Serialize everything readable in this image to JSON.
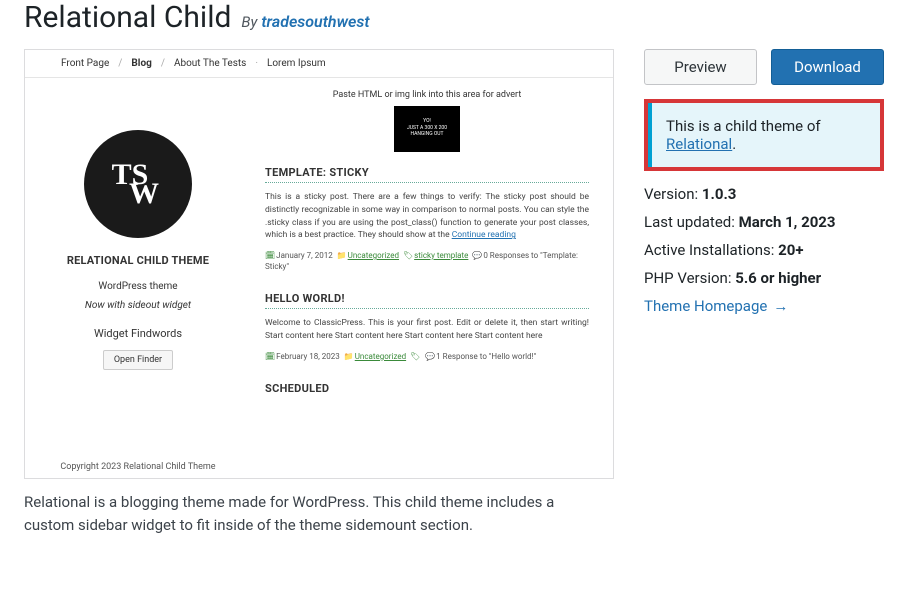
{
  "header": {
    "title": "Relational Child",
    "by_label": "By",
    "author": "tradesouthwest"
  },
  "actions": {
    "preview": "Preview",
    "download": "Download"
  },
  "notice": {
    "text_before": "This is a child theme of ",
    "parent_name": "Relational",
    "text_after": "."
  },
  "meta": {
    "version_label": "Version:",
    "version_value": "1.0.3",
    "updated_label": "Last updated:",
    "updated_value": "March 1, 2023",
    "installs_label": "Active Installations:",
    "installs_value": "20+",
    "php_label": "PHP Version:",
    "php_value": "5.6 or higher",
    "homepage_label": "Theme Homepage"
  },
  "description": "Relational is a blogging theme made for WordPress. This child theme includes a custom sidebar widget to fit inside of the theme sidemount section.",
  "screenshot": {
    "nav": {
      "item1": "Front Page",
      "item2": "Blog",
      "item3": "About The Tests",
      "item4": "Lorem Ipsum"
    },
    "sidebar": {
      "site_title": "RELATIONAL CHILD THEME",
      "tagline": "WordPress theme",
      "subtag": "Now with sideout widget",
      "widget_title": "Widget Findwords",
      "button": "Open Finder",
      "footer": "Copyright 2023 Relational Child Theme"
    },
    "content": {
      "ad_label": "Paste HTML or img link into this area for advert",
      "ad_line1": "YO!",
      "ad_line2": "JUST A 300 X 200",
      "ad_line3": "HANGING OUT",
      "post1": {
        "title": "TEMPLATE: STICKY",
        "body": "This is a sticky post. There are a few things to verify: The sticky post should be distinctly recognizable in some way in comparison to normal posts. You can style the .sticky class if you are using the post_class() function to generate your post classes, which is a best practice. They should show at the ",
        "more": "Continue reading",
        "date": "January 7, 2012",
        "cat": "Uncategorized",
        "tags": "sticky template",
        "responses": "0 Responses to \"Template: Sticky\""
      },
      "post2": {
        "title": "HELLO WORLD!",
        "body": "Welcome to ClassicPress. This is your first post. Edit or delete it, then start writing! Start content here Start content here Start content here Start content here",
        "date": "February 18, 2023",
        "cat": "Uncategorized",
        "responses": "1 Response to \"Hello world!\""
      },
      "post3": {
        "title": "SCHEDULED"
      }
    }
  }
}
